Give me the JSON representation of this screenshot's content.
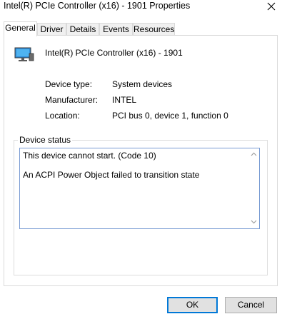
{
  "window": {
    "title": "Intel(R) PCIe Controller (x16) - 1901 Properties",
    "close_icon": "close-icon"
  },
  "tabs": [
    {
      "label": "General",
      "active": true
    },
    {
      "label": "Driver",
      "active": false
    },
    {
      "label": "Details",
      "active": false
    },
    {
      "label": "Events",
      "active": false
    },
    {
      "label": "Resources",
      "active": false
    }
  ],
  "device": {
    "icon": "device-monitor-icon",
    "name": "Intel(R) PCIe Controller (x16) - 1901"
  },
  "properties": [
    {
      "label": "Device type:",
      "value": "System devices"
    },
    {
      "label": "Manufacturer:",
      "value": "INTEL"
    },
    {
      "label": "Location:",
      "value": "PCI bus 0, device 1, function 0"
    }
  ],
  "status": {
    "group_label": "Device status",
    "line1": "This device cannot start. (Code 10)",
    "line2": "An ACPI Power Object failed to transition state"
  },
  "buttons": {
    "ok": "OK",
    "cancel": "Cancel"
  },
  "colors": {
    "focus_border": "#0078d7",
    "textbox_border": "#7a9cd3"
  }
}
